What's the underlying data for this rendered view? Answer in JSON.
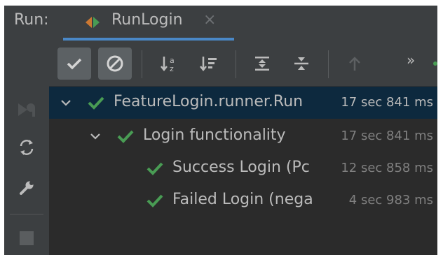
{
  "header": {
    "run_label": "Run:",
    "tab_label": "RunLogin",
    "tab_close": "×"
  },
  "toolbar": {
    "more": "»",
    "buttons": [
      {
        "icon": "show-passed-icon",
        "toggled": true
      },
      {
        "icon": "show-ignored-icon",
        "toggled": true
      },
      {
        "icon": "sort-alphabetically-icon",
        "toggled": false
      },
      {
        "icon": "sort-by-duration-icon",
        "toggled": false
      },
      {
        "icon": "expand-all-icon",
        "toggled": false
      },
      {
        "icon": "collapse-all-icon",
        "toggled": false
      },
      {
        "icon": "previous-failed-test-icon",
        "toggled": false
      }
    ]
  },
  "side": {
    "buttons": [
      "rerun-icon",
      "rerun-failed-icon",
      "toggle-auto-test-icon",
      "settings-wrench-icon",
      "stop-icon"
    ]
  },
  "tree": {
    "rows": [
      {
        "name": "FeatureLogin.runner.Run",
        "time": "17 sec 841 ms",
        "level": 0,
        "expanded": true,
        "status": "passed",
        "selected": true
      },
      {
        "name": "Login functionality",
        "time": "17 sec 841 ms",
        "level": 1,
        "expanded": true,
        "status": "passed",
        "selected": false
      },
      {
        "name": "Success Login (Pc",
        "time": "12 sec 858 ms",
        "level": 2,
        "expanded": false,
        "status": "passed",
        "selected": false
      },
      {
        "name": "Failed Login (nega",
        "time": "4 sec 983 ms",
        "level": 2,
        "expanded": false,
        "status": "passed",
        "selected": false
      }
    ]
  },
  "colors": {
    "panel_bg": "#3c3f41",
    "tree_bg": "#2b2b2b",
    "selection_bg": "#0d293e",
    "pass_green": "#499c54",
    "run_green": "#499c54",
    "text": "#bbbbbb",
    "muted_text": "#808080",
    "tab_underline": "#4a88c7"
  }
}
